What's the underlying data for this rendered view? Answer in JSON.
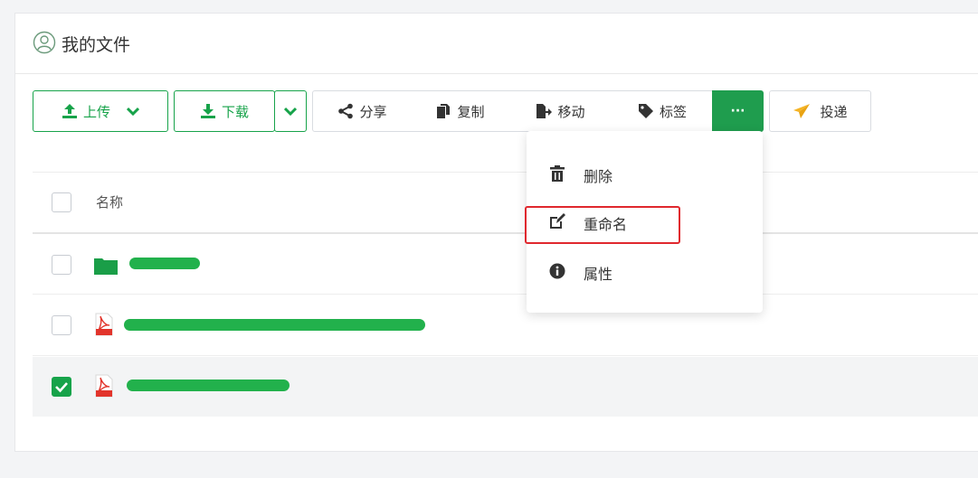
{
  "header": {
    "title": "我的文件",
    "icon": "user-folder-icon"
  },
  "toolbar": {
    "upload": {
      "label": "上传",
      "icon": "upload-icon"
    },
    "download": {
      "label": "下载",
      "icon": "download-icon"
    },
    "share": {
      "label": "分享",
      "icon": "share-icon"
    },
    "copy": {
      "label": "复制",
      "icon": "copy-icon"
    },
    "move": {
      "label": "移动",
      "icon": "move-icon"
    },
    "tag": {
      "label": "标签",
      "icon": "tag-icon"
    },
    "more": {
      "label": "···",
      "icon": "more-icon"
    },
    "deliver": {
      "label": "投递",
      "icon": "paper-plane-icon"
    }
  },
  "table": {
    "column_name": "名称",
    "rows": [
      {
        "type": "folder",
        "checked": false
      },
      {
        "type": "pdf",
        "checked": false
      },
      {
        "type": "pdf",
        "checked": true
      }
    ]
  },
  "menu": {
    "items": [
      {
        "label": "删除",
        "icon": "trash-icon"
      },
      {
        "label": "重命名",
        "icon": "edit-icon"
      },
      {
        "label": "属性",
        "icon": "info-icon"
      }
    ]
  },
  "colors": {
    "accent": "#1f9d4e",
    "highlight": "#e0282e",
    "redaction": "#22b14c"
  }
}
